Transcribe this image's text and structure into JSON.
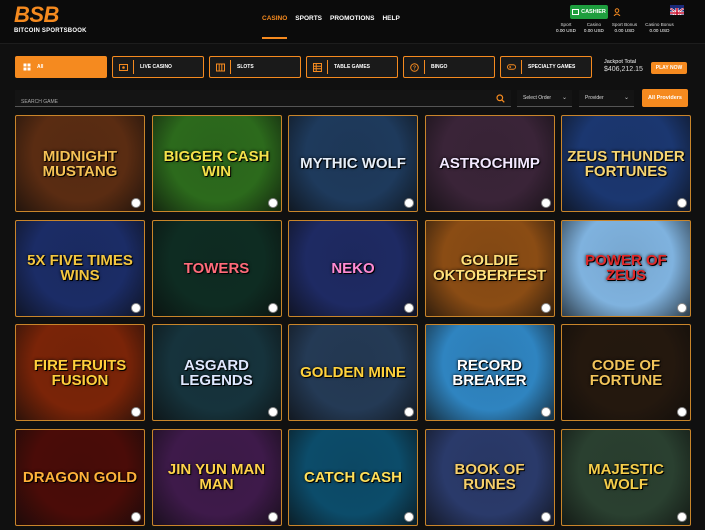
{
  "header": {
    "logo": "BSB",
    "logo_sub": "BITCOIN SPORTSBOOK",
    "nav": [
      "CASINO",
      "SPORTS",
      "PROMOTIONS",
      "HELP"
    ],
    "cashier": "CASHIER",
    "balances": [
      {
        "label": "Sport",
        "value": "0.00 USD"
      },
      {
        "label": "Casino",
        "value": "0.00 USD"
      },
      {
        "label": "Sport Bonus",
        "value": "0.00 USD"
      },
      {
        "label": "Casino Bonus",
        "value": "0.00 USD"
      }
    ]
  },
  "filters": [
    "All",
    "LIVE CASINO",
    "SLOTS",
    "TABLE GAMES",
    "BINGO",
    "SPECIALTY GAMES"
  ],
  "jackpot": {
    "label": "Jackpot Total",
    "amount": "$406,212.15",
    "button": "PLAY NOW"
  },
  "search": {
    "placeholder": "SEARCH GAME"
  },
  "selects": {
    "order": "Select Order",
    "provider": "Provider"
  },
  "all_providers": "All Providers",
  "games": [
    {
      "title": "Midnight Mustang",
      "bg": "#5a2c12",
      "fg": "#f6c255"
    },
    {
      "title": "Bigger Cash Win",
      "bg": "#2c6a1c",
      "fg": "#f4e24a"
    },
    {
      "title": "Mythic Wolf",
      "bg": "#1e3a5c",
      "fg": "#e6eef8"
    },
    {
      "title": "AstroChimp",
      "bg": "#3a2438",
      "fg": "#f2e8ff"
    },
    {
      "title": "Zeus Thunder Fortunes",
      "bg": "#1b3770",
      "fg": "#f7d572"
    },
    {
      "title": "5x Five Times Wins",
      "bg": "#1b2c66",
      "fg": "#f3c640"
    },
    {
      "title": "TOWERS",
      "bg": "#0e2c22",
      "fg": "#ff6b7a"
    },
    {
      "title": "Neko",
      "bg": "#1e2a63",
      "fg": "#ff8bd3"
    },
    {
      "title": "Goldie Oktoberfest",
      "bg": "#8a4c14",
      "fg": "#ffe07a"
    },
    {
      "title": "Power of Zeus",
      "bg": "#7fb2de",
      "fg": "#e0292a"
    },
    {
      "title": "Fire Fruits Fusion",
      "bg": "#7a2408",
      "fg": "#ffcf3c"
    },
    {
      "title": "Asgard Legends",
      "bg": "#16333c",
      "fg": "#dfe8ff"
    },
    {
      "title": "Golden Mine",
      "bg": "#243a55",
      "fg": "#ffd23c"
    },
    {
      "title": "Record Breaker",
      "bg": "#2f84c0",
      "fg": "#ffffff"
    },
    {
      "title": "Code of Fortune",
      "bg": "#24180e",
      "fg": "#f2c45a"
    },
    {
      "title": "Dragon Gold",
      "bg": "#4a0c08",
      "fg": "#ffb23a"
    },
    {
      "title": "Jin Yun Man Man",
      "bg": "#3e1a4a",
      "fg": "#ffd24a"
    },
    {
      "title": "Catch Cash",
      "bg": "#0c4c6a",
      "fg": "#ffe05a"
    },
    {
      "title": "Book of Runes",
      "bg": "#2a3a6a",
      "fg": "#f6cf6a"
    },
    {
      "title": "Majestic Wolf",
      "bg": "#2a4030",
      "fg": "#f4cd4a"
    }
  ]
}
